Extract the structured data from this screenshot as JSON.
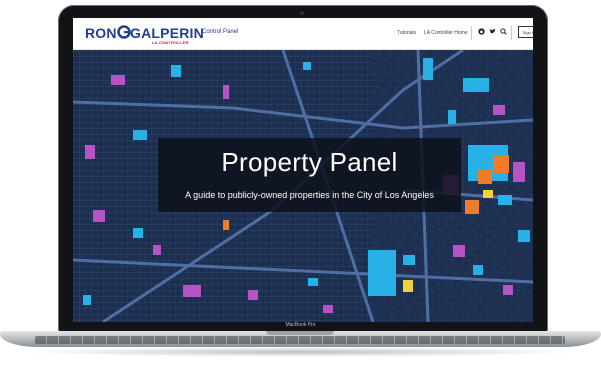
{
  "header": {
    "brand_first": "RON",
    "brand_last": "GALPERIN",
    "brand_sub": "LA CONTROLLER",
    "section_title": "Control Panel",
    "nav_links": [
      "Tutorials",
      "LA Controller Home"
    ],
    "social_icons": [
      "github-icon",
      "twitter-icon"
    ],
    "search_icon": "search-icon",
    "sign_in_label": "Sign In"
  },
  "hero": {
    "title": "Property Panel",
    "subtitle": "A guide to publicly-owned properties in the City of Los Angeles"
  },
  "device": {
    "label": "MacBook Pro"
  },
  "colors": {
    "brand_blue": "#23408e",
    "brand_red": "#c8242b",
    "map_background": "#1d3153",
    "parcel_cyan": "#27b1e6",
    "parcel_magenta": "#b654c5",
    "parcel_orange": "#f07c2a",
    "parcel_yellow": "#f2d23a"
  }
}
